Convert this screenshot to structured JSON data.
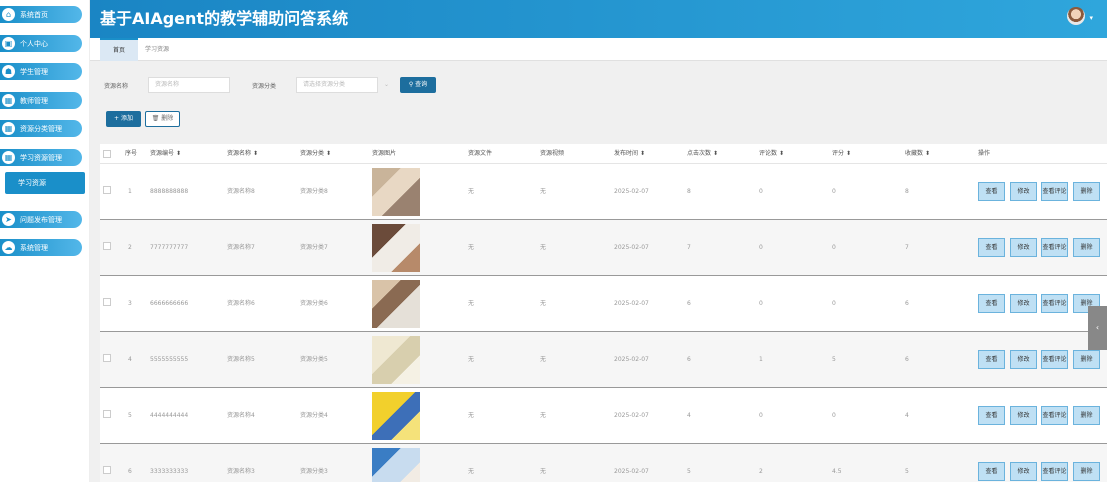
{
  "app": {
    "title": "基于AIAgent的教学辅助问答系统"
  },
  "sidebar": {
    "items": [
      {
        "label": "系统首页",
        "icon": "home-icon"
      },
      {
        "label": "个人中心",
        "icon": "user-icon"
      },
      {
        "label": "学生管理",
        "icon": "folder-icon"
      },
      {
        "label": "教师管理",
        "icon": "grid-icon"
      },
      {
        "label": "资源分类管理",
        "icon": "grid-icon"
      },
      {
        "label": "学习资源管理",
        "icon": "grid-icon"
      },
      {
        "label": "问题发布管理",
        "icon": "send-icon"
      },
      {
        "label": "系统管理",
        "icon": "cloud-icon"
      }
    ],
    "sub_active": "学习资源"
  },
  "tabs": [
    {
      "label": "首页",
      "active": true
    },
    {
      "label": "学习资源",
      "active": false
    }
  ],
  "filters": {
    "name_label": "资源名称",
    "name_placeholder": "资源名称",
    "category_label": "资源分类",
    "category_placeholder": "请选择资源分类",
    "search_label": "查询"
  },
  "actions": {
    "add_label": "+ 添加",
    "delete_label": "删除"
  },
  "table": {
    "headers": [
      "序号",
      "资源编号",
      "资源名称",
      "资源分类",
      "资源图片",
      "资源文件",
      "资源视频",
      "发布时间",
      "点击次数",
      "评论数",
      "评分",
      "收藏数",
      "操作"
    ],
    "row_buttons": [
      "查看",
      "修改",
      "查看评论",
      "删除"
    ],
    "rows": [
      {
        "idx": "1",
        "code": "8888888888",
        "name": "资源名称8",
        "category": "资源分类8",
        "file": "无",
        "video": "无",
        "date": "2025-02-07",
        "clicks": "8",
        "comments": "0",
        "score": "0",
        "favs": "8"
      },
      {
        "idx": "2",
        "code": "7777777777",
        "name": "资源名称7",
        "category": "资源分类7",
        "file": "无",
        "video": "无",
        "date": "2025-02-07",
        "clicks": "7",
        "comments": "0",
        "score": "0",
        "favs": "7"
      },
      {
        "idx": "3",
        "code": "6666666666",
        "name": "资源名称6",
        "category": "资源分类6",
        "file": "无",
        "video": "无",
        "date": "2025-02-07",
        "clicks": "6",
        "comments": "0",
        "score": "0",
        "favs": "6"
      },
      {
        "idx": "4",
        "code": "5555555555",
        "name": "资源名称5",
        "category": "资源分类5",
        "file": "无",
        "video": "无",
        "date": "2025-02-07",
        "clicks": "6",
        "comments": "1",
        "score": "5",
        "favs": "6"
      },
      {
        "idx": "5",
        "code": "4444444444",
        "name": "资源名称4",
        "category": "资源分类4",
        "file": "无",
        "video": "无",
        "date": "2025-02-07",
        "clicks": "4",
        "comments": "0",
        "score": "0",
        "favs": "4"
      },
      {
        "idx": "6",
        "code": "3333333333",
        "name": "资源名称3",
        "category": "资源分类3",
        "file": "无",
        "video": "无",
        "date": "2025-02-07",
        "clicks": "5",
        "comments": "2",
        "score": "4.5",
        "favs": "5"
      }
    ]
  },
  "colors": {
    "accent": "#1a8fc9",
    "header": "#1a85c4",
    "button_dark": "#1d6e9e",
    "op_button": "#bfe0f4"
  }
}
